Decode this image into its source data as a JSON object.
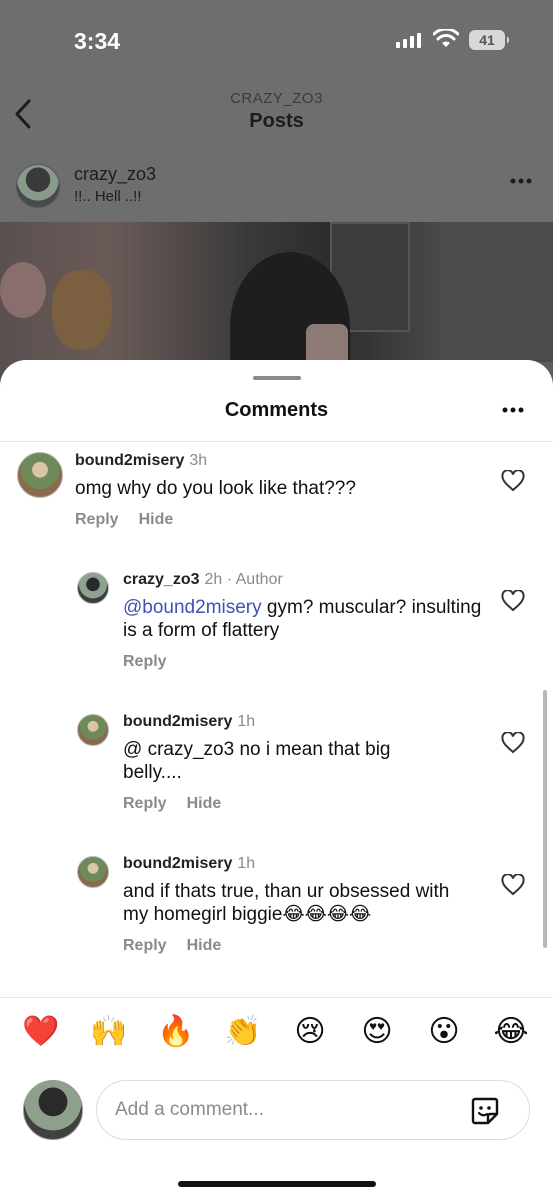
{
  "status_bar": {
    "time": "3:34",
    "battery": "41"
  },
  "nav": {
    "subtitle": "CRAZY_ZO3",
    "title": "Posts"
  },
  "post": {
    "username": "crazy_zo3",
    "caption": "!!.. Hell ..!!"
  },
  "sheet": {
    "title": "Comments"
  },
  "comments": [
    {
      "user": "bound2misery",
      "time": "3h",
      "text": "omg why do you look like that???",
      "reply": "Reply",
      "hide": "Hide"
    },
    {
      "user": "crazy_zo3",
      "time": "2h · Author",
      "mention": "@bound2misery",
      "text": " gym? muscular? insulting is a form of flattery",
      "reply": "Reply"
    },
    {
      "user": "bound2misery",
      "time": "1h",
      "text": "@ crazy_zo3 no i mean that big belly....",
      "reply": "Reply",
      "hide": "Hide"
    },
    {
      "user": "bound2misery",
      "time": "1h",
      "text": "and if thats true, than ur obsessed with my homegirl biggie😂😂😂😂",
      "reply": "Reply",
      "hide": "Hide"
    }
  ],
  "quick_reactions": [
    "❤️",
    "🙌",
    "🔥",
    "👏",
    "😢",
    "😍",
    "😮",
    "😂"
  ],
  "composer": {
    "placeholder": "Add a comment..."
  }
}
